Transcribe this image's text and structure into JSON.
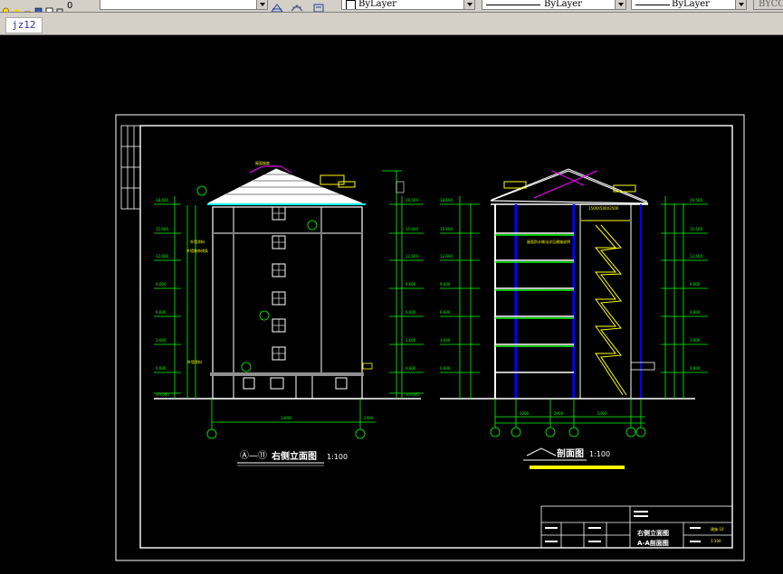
{
  "toolbar": {
    "layer_combo_value": "0",
    "color_combo_value": "ByLayer",
    "linetype_combo_value": "ByLayer",
    "lineweight_combo_value": "ByLayer",
    "plotstyle_combo_value": "BYCO"
  },
  "tabs": [
    {
      "label": "jz12"
    }
  ],
  "drawing": {
    "elevation_title": "右侧立面图",
    "elevation_axis_label": "Ⓐ—⑪",
    "elevation_scale": "1:100",
    "section_title": "剖面图",
    "section_scale": "1:100",
    "title_block_line1": "右侧立面图",
    "title_block_line2": "A-A剖面图"
  },
  "colors": {
    "background": "#000000",
    "dim_green": "#00ff00",
    "white": "#ffffff",
    "yellow": "#ffff00",
    "magenta": "#ff00ff",
    "cyan": "#00ffff",
    "blue": "#0000ff"
  }
}
